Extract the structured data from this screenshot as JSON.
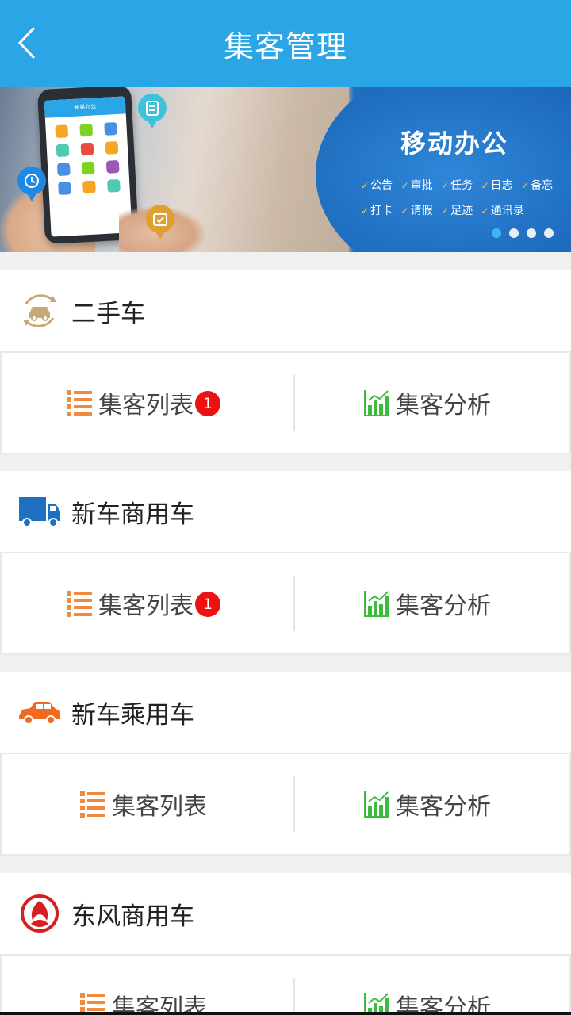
{
  "header": {
    "title": "集客管理",
    "back_icon": "chevron-left-icon"
  },
  "banner": {
    "title": "移动办公",
    "tags_row1": [
      "公告",
      "审批",
      "任务",
      "日志",
      "备忘"
    ],
    "tags_row2": [
      "打卡",
      "请假",
      "足迹",
      "通讯录"
    ],
    "dots_total": 4,
    "dots_active_index": 0,
    "phone_screen_title": "新易办公"
  },
  "colors": {
    "header": "#2aa5e6",
    "badge": "#ee1111",
    "list_icon": "#f08a3c",
    "chart_icon": "#3cbb3c"
  },
  "sections": [
    {
      "title": "二手车",
      "icon": "used-car-icon",
      "list_label": "集客列表",
      "list_badge": "1",
      "analysis_label": "集客分析"
    },
    {
      "title": "新车商用车",
      "icon": "truck-icon",
      "list_label": "集客列表",
      "list_badge": "1",
      "analysis_label": "集客分析"
    },
    {
      "title": "新车乘用车",
      "icon": "car-icon",
      "list_label": "集客列表",
      "list_badge": "",
      "analysis_label": "集客分析"
    },
    {
      "title": "东风商用车",
      "icon": "dongfeng-logo-icon",
      "list_label": "集客列表",
      "list_badge": "",
      "analysis_label": "集客分析"
    }
  ]
}
